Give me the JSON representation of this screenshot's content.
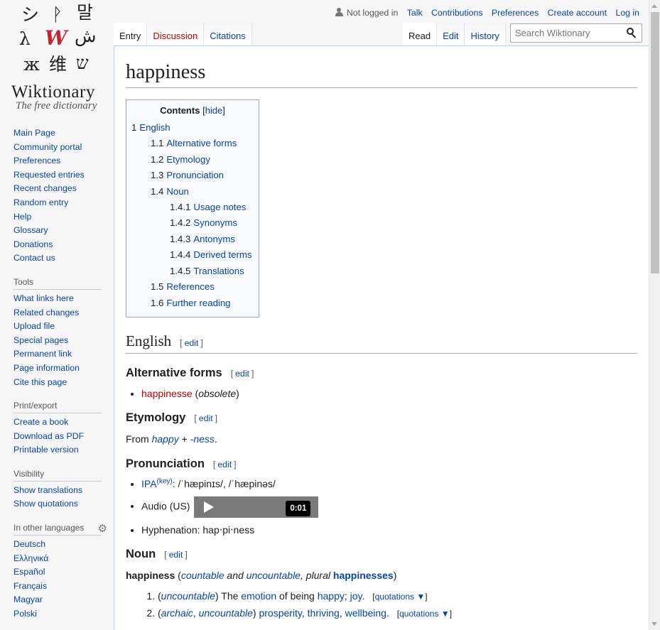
{
  "logo": {
    "glyphs": [
      "シ",
      "ᚹ",
      "말",
      "λ",
      "W",
      "ش",
      "ж",
      "维",
      "ש"
    ],
    "title": "Wiktionary",
    "tagline": "The free dictionary"
  },
  "sidebar": {
    "nav": [
      "Main Page",
      "Community portal",
      "Preferences",
      "Requested entries",
      "Recent changes",
      "Random entry",
      "Help",
      "Glossary",
      "Donations",
      "Contact us"
    ],
    "tools": {
      "heading": "Tools",
      "items": [
        "What links here",
        "Related changes",
        "Upload file",
        "Special pages",
        "Permanent link",
        "Page information",
        "Cite this page"
      ]
    },
    "print": {
      "heading": "Print/export",
      "items": [
        "Create a book",
        "Download as PDF",
        "Printable version"
      ]
    },
    "visibility": {
      "heading": "Visibility",
      "items": [
        "Show translations",
        "Show quotations"
      ]
    },
    "languages": {
      "heading": "In other languages",
      "items": [
        "Deutsch",
        "Ελληνικά",
        "Español",
        "Français",
        "Magyar",
        "Polski"
      ]
    }
  },
  "personal": {
    "status": "Not logged in",
    "links": [
      "Talk",
      "Contributions",
      "Preferences",
      "Create account",
      "Log in"
    ]
  },
  "tabs": {
    "left": [
      "Entry",
      "Discussion",
      "Citations"
    ],
    "right": [
      "Read",
      "Edit",
      "History"
    ]
  },
  "search": {
    "placeholder": "Search Wiktionary"
  },
  "page": {
    "title": "happiness",
    "toc": {
      "title": "Contents",
      "toggle": "hide",
      "items": [
        {
          "num": "1",
          "label": "English"
        },
        {
          "num": "1.1",
          "label": "Alternative forms"
        },
        {
          "num": "1.2",
          "label": "Etymology"
        },
        {
          "num": "1.3",
          "label": "Pronunciation"
        },
        {
          "num": "1.4",
          "label": "Noun"
        },
        {
          "num": "1.4.1",
          "label": "Usage notes"
        },
        {
          "num": "1.4.2",
          "label": "Synonyms"
        },
        {
          "num": "1.4.3",
          "label": "Antonyms"
        },
        {
          "num": "1.4.4",
          "label": "Derived terms"
        },
        {
          "num": "1.4.5",
          "label": "Translations"
        },
        {
          "num": "1.5",
          "label": "References"
        },
        {
          "num": "1.6",
          "label": "Further reading"
        }
      ]
    },
    "edit_label": "edit",
    "lang_heading": "English",
    "alt_forms": {
      "heading": "Alternative forms",
      "word": "happinesse",
      "note": "obsolete"
    },
    "etymology": {
      "heading": "Etymology",
      "from": "From",
      "root": "happy",
      "plus": "+",
      "suffix": "-ness",
      "end": "."
    },
    "pronunciation": {
      "heading": "Pronunciation",
      "ipa_label": "IPA",
      "key": "(key)",
      "ipa": ": /ˈhæpinɪs/, /ˈhæpinəs/",
      "audio_label": "Audio (US)",
      "audio_time": "0:01",
      "hyphenation": "Hyphenation: hap‧pi‧ness"
    },
    "noun": {
      "heading": "Noun",
      "headword": "happiness",
      "countable": "countable",
      "and": "and",
      "uncountable": "uncountable",
      "plural": ", plural",
      "plural_form": "happinesses",
      "senses": [
        {
          "label1": "uncountable",
          "pre": "The",
          "w1": "emotion",
          "mid": "of being",
          "w2": "happy",
          "sep": ";",
          "w3": "joy",
          "end": "."
        },
        {
          "label1": "archaic",
          "label2": "uncountable",
          "w1": "prosperity",
          "w2": "thriving",
          "w3": "wellbeing",
          "end": "."
        }
      ],
      "quotations": "quotations ▼"
    }
  }
}
